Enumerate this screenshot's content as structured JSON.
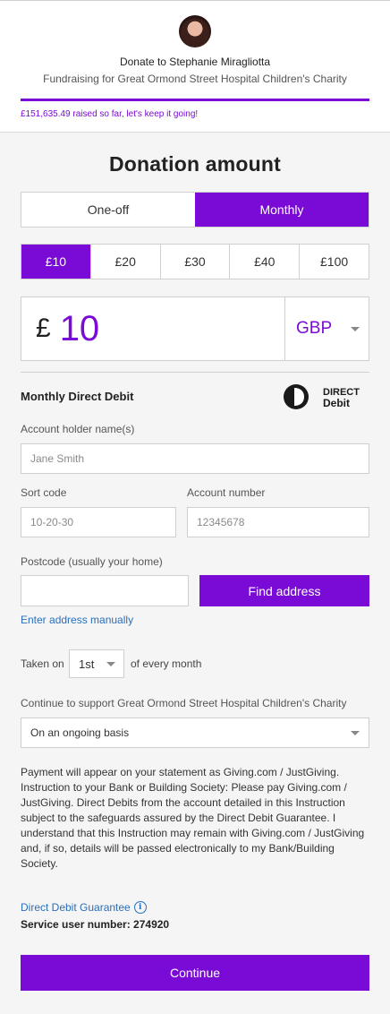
{
  "header": {
    "donate_to": "Donate to Stephanie Miragliotta",
    "fundraising": "Fundraising for Great Ormond Street Hospital Children's Charity",
    "raised": "£151,635.49 raised so far, let's keep it going!",
    "progress_fraction": 1.0
  },
  "form": {
    "title": "Donation amount",
    "frequency": [
      {
        "label": "One-off",
        "active": false
      },
      {
        "label": "Monthly",
        "active": true
      }
    ],
    "amounts": [
      {
        "label": "£10",
        "active": true
      },
      {
        "label": "£20",
        "active": false
      },
      {
        "label": "£30",
        "active": false
      },
      {
        "label": "£40",
        "active": false
      },
      {
        "label": "£100",
        "active": false
      }
    ],
    "currency_symbol": "£",
    "amount_value": "10",
    "currency_code": "GBP"
  },
  "direct_debit": {
    "title": "Monthly Direct Debit",
    "logo_text_1": "DIRECT",
    "logo_text_2": "Debit",
    "account_holder_label": "Account holder name(s)",
    "account_holder_placeholder": "Jane Smith",
    "sort_code_label": "Sort code",
    "sort_code_placeholder": "10-20-30",
    "account_number_label": "Account number",
    "account_number_placeholder": "12345678",
    "postcode_label": "Postcode (usually your home)",
    "postcode_placeholder": "",
    "find_address": "Find address",
    "enter_manually": "Enter address manually",
    "taken_on": "Taken on",
    "day": "1st",
    "every_month": "of every month",
    "continue_support_label": "Continue to support Great Ormond Street Hospital Children's Charity",
    "continue_support_value": "On an ongoing basis",
    "payment_text": "Payment will appear on your statement as Giving.com / JustGiving. Instruction to your Bank or Building Society: Please pay Giving.com / JustGiving. Direct Debits from the account detailed in this Instruction subject to the safeguards assured by the Direct Debit Guarantee. I understand that this Instruction may remain with Giving.com / JustGiving and, if so, details will be passed electronically to my Bank/Building Society.",
    "guarantee_link": "Direct Debit Guarantee",
    "service_user": "Service user number: 274920",
    "continue_button": "Continue"
  },
  "colors": {
    "accent": "#7a0bd6",
    "link": "#2a6ebb",
    "page_bg": "#f5f5f5"
  }
}
